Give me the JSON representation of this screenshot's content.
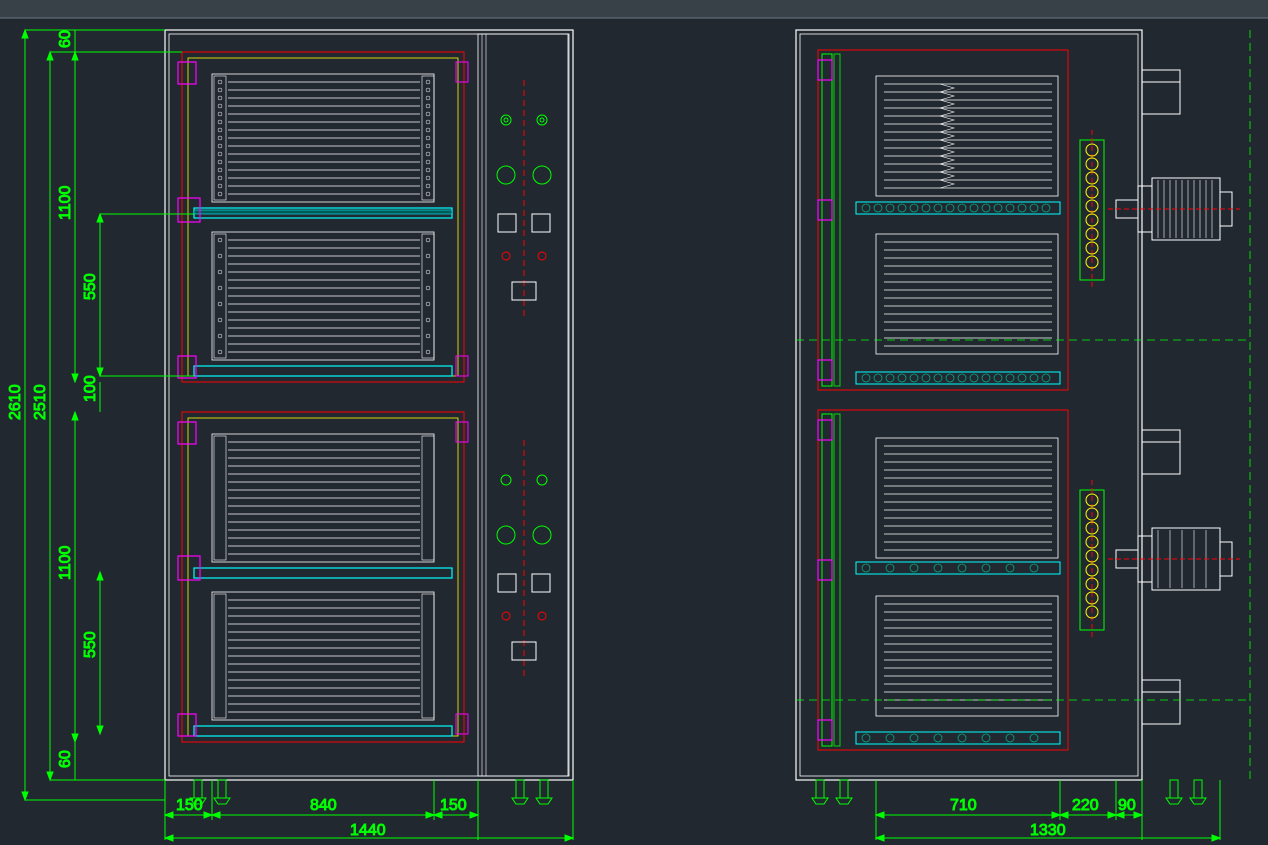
{
  "dimensions": {
    "front_view": {
      "overall_width": "1440",
      "overall_height": "2610",
      "inner_height": "2510",
      "left_margin": "150",
      "center_width": "840",
      "right_margin": "150",
      "chamber_height": "1100",
      "tray_zone_height": "550",
      "gap_100": "100",
      "top_gap": "60",
      "bottom_gap": "60"
    },
    "side_view": {
      "overall_width": "1330",
      "core_width": "710",
      "motor_gap": "220",
      "end_gap": "90"
    }
  },
  "colors": {
    "dim": "#00ff00",
    "outline": "#ffffff",
    "accent_red": "#ff0000",
    "accent_yellow": "#ffff00",
    "accent_cyan": "#00ffff",
    "accent_magenta": "#ff00ff",
    "grid": "#404a56"
  }
}
